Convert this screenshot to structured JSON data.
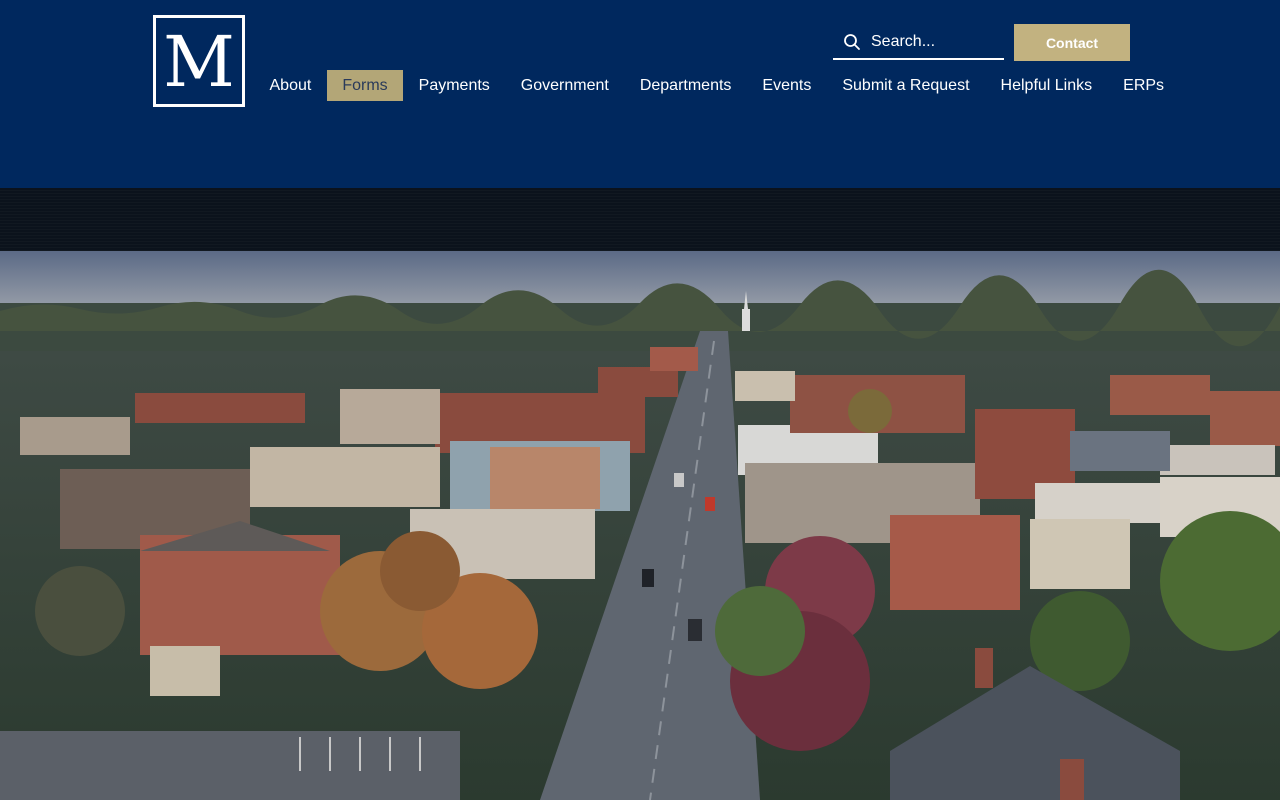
{
  "logo": {
    "letter": "M"
  },
  "search": {
    "placeholder": "Search...",
    "icon": "search-icon"
  },
  "contact_button": {
    "label": "Contact"
  },
  "nav": {
    "active": "Forms",
    "items": [
      {
        "label": "About"
      },
      {
        "label": "Forms"
      },
      {
        "label": "Payments"
      },
      {
        "label": "Government"
      },
      {
        "label": "Departments"
      },
      {
        "label": "Events"
      },
      {
        "label": "Submit a Request"
      },
      {
        "label": "Helpful Links"
      },
      {
        "label": "ERPs"
      }
    ]
  },
  "colors": {
    "header_bg": "#00285e",
    "accent_gold": "#c2b280",
    "active_tab": "#b3a677"
  }
}
